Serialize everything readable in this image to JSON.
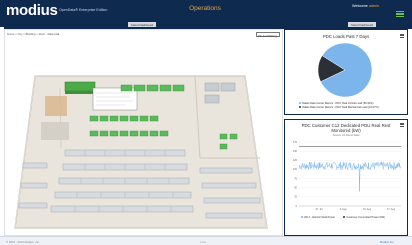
{
  "header": {
    "logo": "modius",
    "edition": "OpenData® Enterprise Edition",
    "title": "Operations",
    "welcome": "Welcome",
    "user": "admin"
  },
  "tabs": {
    "left": "Select Dashboard",
    "right": "Select Dashboard"
  },
  "floor": {
    "breadcrumb": "Home > City > Building > Floor - Data Hall",
    "floor_select": "P2: 1st Whiting"
  },
  "pie_chart": {
    "title": "PDC Loads Past 7 Days"
  },
  "line_chart": {
    "title": "PDC Customer C12 Dedicated PDU Real Rest Monitored (kW)",
    "subtitle": "Source: A1 Demo Data"
  },
  "chart_data": [
    {
      "type": "pie",
      "title": "PDC Loads Past 7 Days",
      "slices": [
        {
          "label": "Dallas Data Center Metrics - PDC Total Critical Load (83.93%)",
          "value": 83.93,
          "color": "#7cb5ec"
        },
        {
          "label": "Dallas Data Center Metrics - PDC Total Mechanical Load (16.07%)",
          "value": 16.07,
          "color": "#2b2f36"
        }
      ]
    },
    {
      "type": "line",
      "title": "PDC Customer C12 Dedicated PDU Real Rest Monitored (kW)",
      "subtitle": "Source: A1 Demo Data",
      "ylim": [
        0,
        175
      ],
      "yticks": [
        0,
        25,
        50,
        75,
        100,
        125,
        150,
        175
      ],
      "xticks": [
        "27. Jul",
        "3. Aug",
        "10. Aug",
        "17. Aug"
      ],
      "series": [
        {
          "name": "kW 4 - Electric Real Power",
          "color": "#7cb5ec"
        },
        {
          "name": "Customer Committed Power (kW)",
          "color": "#333333"
        }
      ],
      "baseline": 110,
      "committed": 162,
      "dip_value": 40
    }
  ],
  "footer": {
    "copyright": "© 2016 - 2019 Modius, Inc.",
    "version": "v 4.x",
    "link": "Modius Inc."
  },
  "colors": {
    "header_bg": "#0f2a4f",
    "accent_orange": "#e8a33a",
    "accent_green": "#6fc04a"
  }
}
